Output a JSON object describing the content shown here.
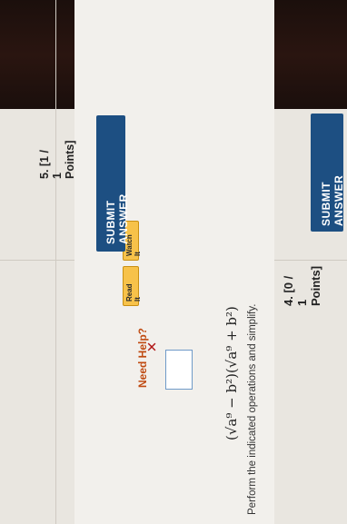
{
  "top_button": {
    "label": "SUBMIT ANSWER"
  },
  "question4": {
    "header": "4.  [0 / 1 Points]",
    "prompt": "Perform the indicated operations and simplify.",
    "expression": "(√a⁹ − b²)(√a⁹ + b²)",
    "answer_value": "",
    "status": "✕",
    "help_label": "Need Help?",
    "read_it": "Read It",
    "watch_it": "Watch It",
    "submit_label": "SUBMIT ANSWER"
  },
  "question5": {
    "header": "5.  [1 / 1 Points]"
  },
  "colors": {
    "button": "#1d4f82",
    "help_text": "#c04b12",
    "help_buttons": "#f7c24a",
    "wrong": "#b11616"
  }
}
